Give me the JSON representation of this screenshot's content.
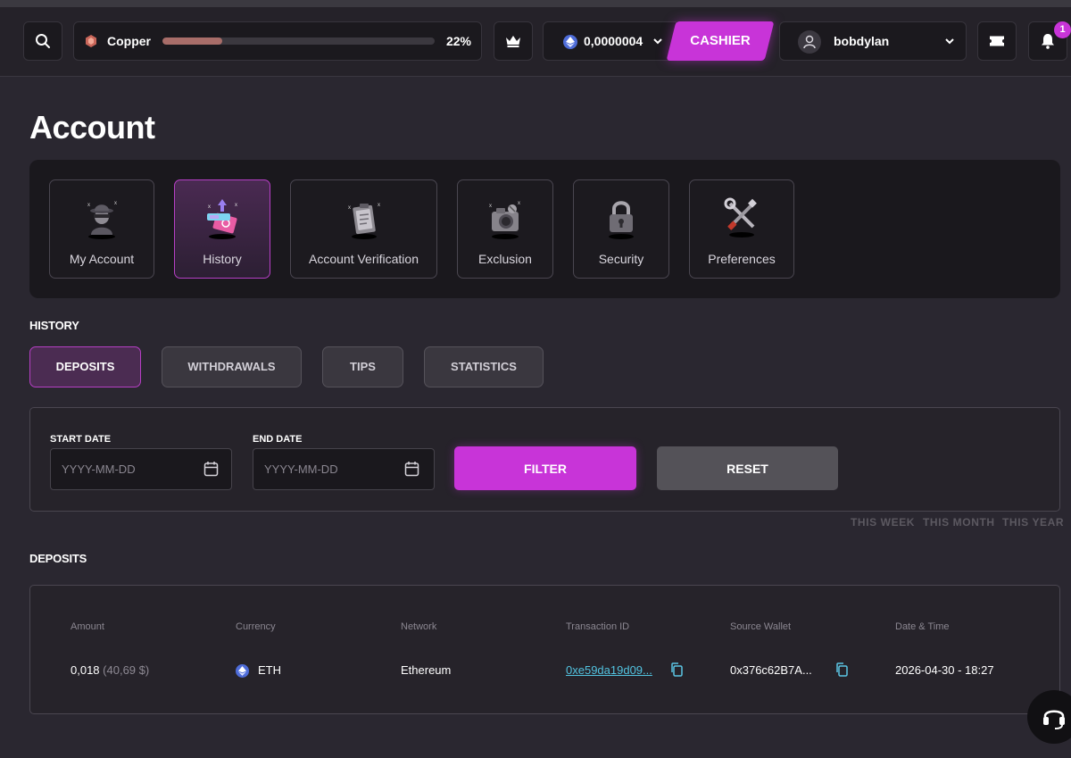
{
  "topbar": {
    "rank": {
      "name": "Copper",
      "progress_percent": 22,
      "percent_label": "22%",
      "color": "#a86d69"
    },
    "balance": {
      "value": "0,0000004",
      "currency_icon": "ethereum-icon"
    },
    "cashier_label": "CASHIER",
    "user": {
      "name": "bobdylan"
    },
    "notifications_count": "1",
    "accent_color": "#c834d8"
  },
  "page": {
    "title": "Account"
  },
  "categories": [
    {
      "label": "My Account",
      "icon": "spy-icon",
      "active": false
    },
    {
      "label": "History",
      "icon": "history-icon",
      "active": true
    },
    {
      "label": "Account Verification",
      "icon": "clipboard-icon",
      "active": false
    },
    {
      "label": "Exclusion",
      "icon": "camera-icon",
      "active": false
    },
    {
      "label": "Security",
      "icon": "padlock-icon",
      "active": false
    },
    {
      "label": "Preferences",
      "icon": "tools-icon",
      "active": false
    }
  ],
  "history": {
    "title": "HISTORY",
    "tabs": [
      {
        "label": "DEPOSITS",
        "active": true
      },
      {
        "label": "WITHDRAWALS",
        "active": false
      },
      {
        "label": "TIPS",
        "active": false
      },
      {
        "label": "STATISTICS",
        "active": false
      }
    ]
  },
  "filter": {
    "start_label": "START DATE",
    "end_label": "END DATE",
    "start_placeholder": "YYYY-MM-DD",
    "end_placeholder": "YYYY-MM-DD",
    "filter_button": "FILTER",
    "reset_button": "RESET",
    "quick_ranges": [
      "THIS WEEK",
      "THIS MONTH",
      "THIS YEAR"
    ]
  },
  "deposits": {
    "title": "DEPOSITS",
    "columns": [
      "Amount",
      "Currency",
      "Network",
      "Transaction ID",
      "Source Wallet",
      "Date & Time"
    ],
    "rows": [
      {
        "amount": "0,018",
        "amount_fiat": "(40,69 $)",
        "currency": "ETH",
        "network": "Ethereum",
        "transaction_id": "0xe59da19d09...",
        "source_wallet": "0x376c62B7A...",
        "datetime": "2026-04-30 - 18:27"
      }
    ]
  }
}
